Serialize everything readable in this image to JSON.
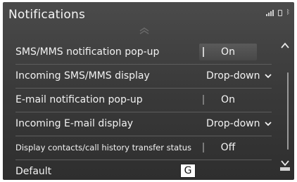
{
  "header": {
    "title": "Notifications"
  },
  "status_icons": [
    "signal-icon",
    "phone-icon",
    "bluetooth-icon"
  ],
  "settings": [
    {
      "label": "SMS/MMS notification pop-up",
      "control": "toggle",
      "value": "On"
    },
    {
      "label": "Incoming SMS/MMS display",
      "control": "dropdown",
      "value": "Drop-down"
    },
    {
      "label": "E-mail notification pop-up",
      "control": "toggle",
      "value": "On"
    },
    {
      "label": "Incoming E-mail display",
      "control": "dropdown",
      "value": "Drop-down"
    },
    {
      "label": "Display contacts/call history transfer status",
      "control": "toggle",
      "value": "Off"
    },
    {
      "label": "Default",
      "control": "button",
      "badge": "G"
    }
  ],
  "colors": {
    "background": "#3b3b3b",
    "text": "#f2f2f2",
    "badge_bg": "#ffffff"
  }
}
